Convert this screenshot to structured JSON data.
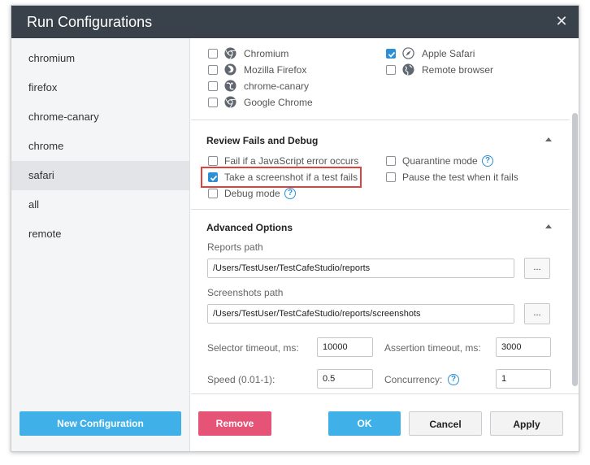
{
  "dialog": {
    "title": "Run Configurations",
    "close_glyph": "✕"
  },
  "sidebar": {
    "items": [
      {
        "label": "chromium"
      },
      {
        "label": "firefox"
      },
      {
        "label": "chrome-canary"
      },
      {
        "label": "chrome"
      },
      {
        "label": "safari",
        "active": true
      },
      {
        "label": "all"
      },
      {
        "label": "remote"
      }
    ],
    "new_button": "New Configuration"
  },
  "browsers": {
    "left": [
      {
        "label": "Chromium",
        "icon": "chromium-icon",
        "checked": false
      },
      {
        "label": "Mozilla Firefox",
        "icon": "firefox-icon",
        "checked": false
      },
      {
        "label": "chrome-canary",
        "icon": "chrome-canary-icon",
        "checked": false
      },
      {
        "label": "Google Chrome",
        "icon": "chrome-icon",
        "checked": false
      }
    ],
    "right": [
      {
        "label": "Apple Safari",
        "icon": "safari-icon",
        "checked": true
      },
      {
        "label": "Remote browser",
        "icon": "globe-icon",
        "checked": false
      }
    ]
  },
  "review": {
    "title": "Review Fails and Debug",
    "options": {
      "js_error": {
        "label": "Fail if a JavaScript error occurs",
        "checked": false
      },
      "screenshot": {
        "label": "Take a screenshot if a test fails",
        "checked": true
      },
      "debug": {
        "label": "Debug mode",
        "checked": false
      },
      "quarantine": {
        "label": "Quarantine mode",
        "checked": false
      },
      "pause": {
        "label": "Pause the test when it fails",
        "checked": false
      }
    },
    "help_glyph": "?"
  },
  "advanced": {
    "title": "Advanced Options",
    "reports_path_label": "Reports path",
    "reports_path_value": "/Users/TestUser/TestCafeStudio/reports",
    "screenshots_path_label": "Screenshots path",
    "screenshots_path_value": "/Users/TestUser/TestCafeStudio/reports/screenshots",
    "browse_label": "...",
    "selector_timeout_label": "Selector timeout, ms:",
    "selector_timeout_value": "10000",
    "assertion_timeout_label": "Assertion timeout, ms:",
    "assertion_timeout_value": "3000",
    "speed_label": "Speed (0.01-1):",
    "speed_value": "0.5",
    "concurrency_label": "Concurrency:",
    "concurrency_value": "1"
  },
  "footer": {
    "remove": "Remove",
    "ok": "OK",
    "cancel": "Cancel",
    "apply": "Apply"
  },
  "colors": {
    "accent": "#3fb1e8",
    "danger": "#e55476",
    "titlebar": "#39414b",
    "highlight": "#e0413b",
    "check": "#2d8fd5"
  }
}
